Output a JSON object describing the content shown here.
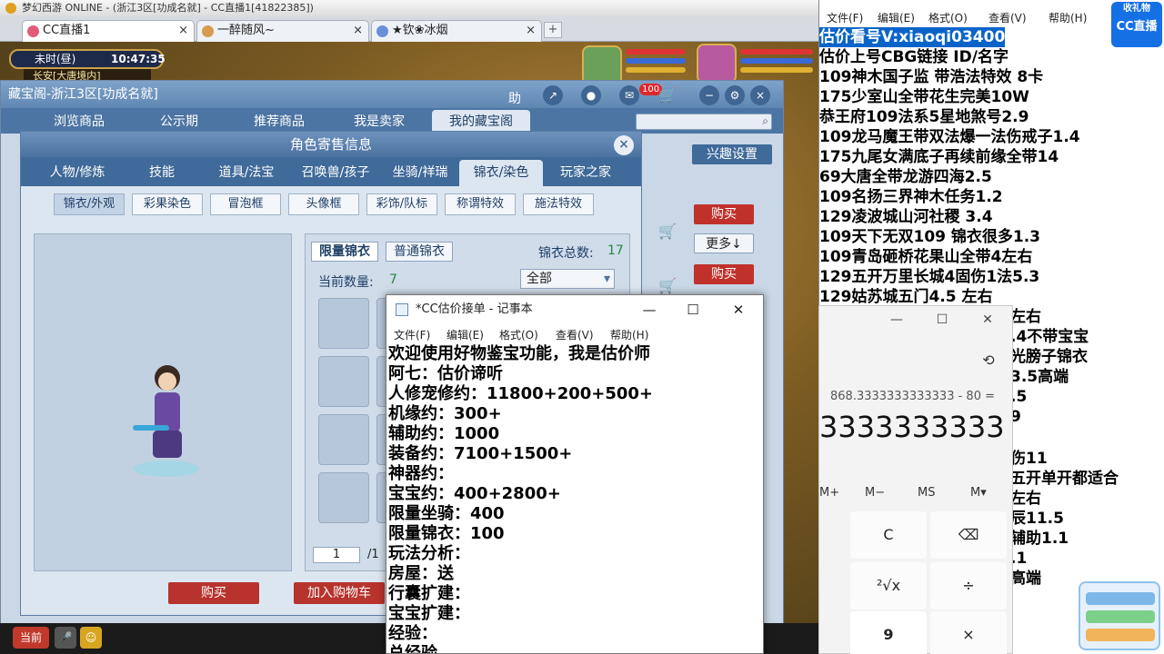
{
  "game": {
    "window_title": "梦幻西游 ONLINE - (浙江3区[功成名就] - CC直播1[41822385])",
    "tabs": [
      {
        "label": "CC直播1",
        "active": true
      },
      {
        "label": "一醉随风~",
        "active": false
      },
      {
        "label": "★钦❀冰烟",
        "active": false
      }
    ],
    "new_tab": "+",
    "close_glyph": "×",
    "hud": {
      "period": "未时(昼)",
      "clock": "10:47:35",
      "location": "长安[大唐境内]"
    },
    "cbg": {
      "title": "藏宝阁-浙江3区[功成名就]",
      "header_help": "助",
      "cart_badge": "100",
      "nav_tabs": [
        "浏览商品",
        "公示期",
        "推荐商品",
        "我是卖家",
        "我的藏宝阁"
      ],
      "interest_button": "兴趣设置",
      "buy_label": "购买",
      "more_label": "更多↓"
    },
    "role": {
      "title": "角色寄售信息",
      "close": "×",
      "tabs": [
        "人物/修炼",
        "技能",
        "道具/法宝",
        "召唤兽/孩子",
        "坐骑/祥瑞",
        "锦衣/染色",
        "玩家之家"
      ],
      "subtabs": [
        "锦衣/外观",
        "彩果染色",
        "冒泡框",
        "头像框",
        "彩饰/队标",
        "称谓特效",
        "施法特效"
      ],
      "list_tabs": [
        "限量锦衣",
        "普通锦衣"
      ],
      "total_label": "锦衣总数:",
      "total_value": "17",
      "count_label": "当前数量:",
      "count_value": "7",
      "filter_value": "全部",
      "page_current": "1",
      "page_total": "/1",
      "buy_button": "购买",
      "add_cart_button": "加入购物车"
    },
    "chat": {
      "current_channel": "当前"
    }
  },
  "notepad_small": {
    "title": "*CC估价接单 - 记事本",
    "menu": [
      "文件(F)",
      "编辑(E)",
      "格式(O)",
      "查看(V)",
      "帮助(H)"
    ],
    "lines": [
      "欢迎使用好物鉴宝功能，我是估价师",
      "阿七：估价谛听",
      "人修宠修约：11800+200+500+",
      "机缘约：300+",
      "辅助约：1000",
      "装备约：7100+1500+",
      "神器约：",
      "宝宝约：400+2800+",
      "限量坐骑：400",
      "限量锦衣：100",
      "玩法分析：",
      "房屋：送",
      "行囊扩建：",
      "宝宝扩建：",
      "经验：",
      "总经验"
    ]
  },
  "notepad_right": {
    "menu": [
      "文件(F)",
      "编辑(E)",
      "格式(O)",
      "查看(V)",
      "帮助(H)"
    ],
    "selected_line": "估价看号V:xiaoqi03400",
    "lines": [
      "估价上号CBG链接 ID/名字",
      "109神木国子监 带浩法特效 8卡",
      "175少室山全带花生完美10W",
      "恭王府109法系5星地煞号2.9",
      "109龙马魔王带双法爆一法伤戒子1.4",
      "175九尾女满底子再续前缘全带14",
      "69大唐全带龙游四海2.5",
      "109名扬三界神木任务1.2",
      "129凌波城山河社稷   3.4",
      "109天下无双109  锦衣很多1.3",
      "109青岛砸桥花果山全带4左右",
      "129五开万里长城4固伤1法5.3",
      "129姑苏城五门4.5 左右"
    ],
    "tail_lines": [
      "左右",
      ".4不带宝宝",
      "光膀子锦衣",
      "3.5高端",
      ".5",
      "9",
      "伤11",
      "五开单开都适合",
      "左右",
      "辰11.5",
      "辅助1.1",
      ".1",
      "高端"
    ]
  },
  "calculator": {
    "expression": "868.3333333333333 - 80 =",
    "display": "3333333333",
    "memory": [
      "M+",
      "M−",
      "MS",
      "M▾"
    ],
    "keys": [
      "C",
      "⌫",
      "²√x",
      "÷",
      "9",
      "×"
    ],
    "history_icon": "⟲"
  },
  "overlay": {
    "logo": "CC直播",
    "gift": "收礼物"
  }
}
